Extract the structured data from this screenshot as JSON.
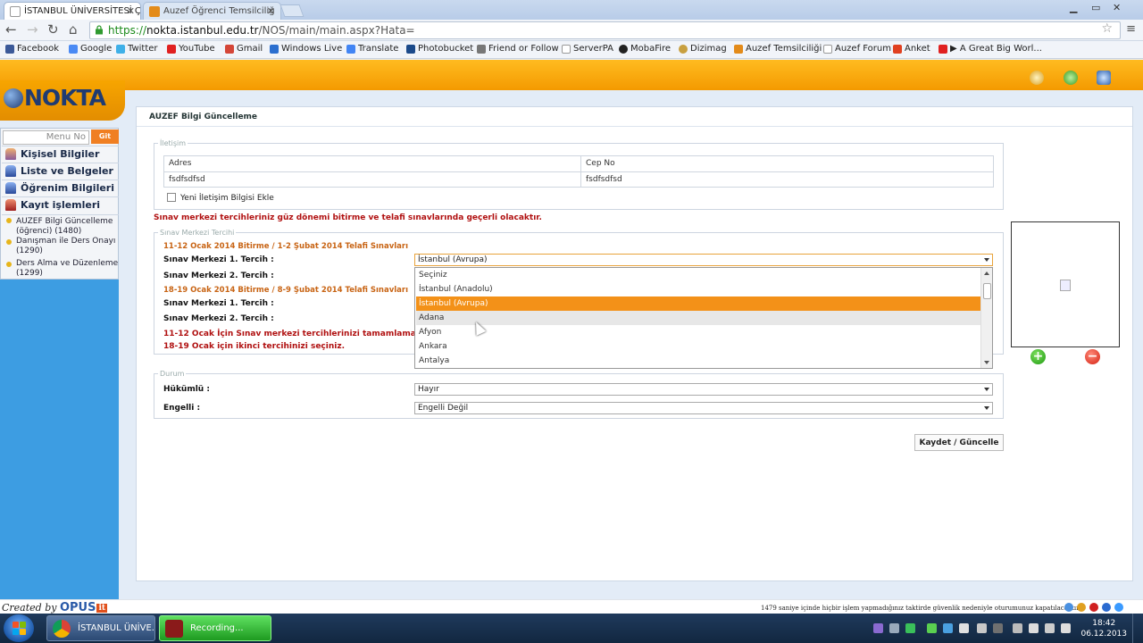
{
  "browser": {
    "tabs": [
      {
        "title": "İSTANBUL ÜNİVERSİTESİ Ç",
        "active": true
      },
      {
        "title": "Auzef Öğrenci Temsilciliğ",
        "active": false
      }
    ],
    "url_scheme": "https://",
    "url_host": "nokta.istanbul.edu.tr",
    "url_path": "/NOS/main/main.aspx?Hata=",
    "bookmarks": [
      "Facebook",
      "Google",
      "Twitter",
      "YouTube",
      "Gmail",
      "Windows Live",
      "Translate",
      "Photobucket",
      "Friend or Follow",
      "ServerPA",
      "MobaFire",
      "Dizimag",
      "Auzef Temsilciliği",
      "Auzef Forum",
      "Anket",
      "A Great Big Worl..."
    ]
  },
  "logo": {
    "text": "NOKTA"
  },
  "sidebar": {
    "menu_no_placeholder": "Menu No",
    "git_label": "Git",
    "items": [
      {
        "label": "Kişisel Bilgiler"
      },
      {
        "label": "Liste ve Belgeler"
      },
      {
        "label": "Öğrenim Bilgileri"
      },
      {
        "label": "Kayıt işlemleri"
      }
    ],
    "subitems": [
      {
        "label": "AUZEF Bilgi Güncelleme (öğrenci) (1480)"
      },
      {
        "label": "Danışman ile Ders Onayı (1290)"
      },
      {
        "label": "Ders Alma ve Düzenleme (1299)"
      }
    ]
  },
  "panel": {
    "title": "AUZEF Bilgi Güncelleme",
    "iletisim": {
      "legend": "İletişim",
      "headers": [
        "Adres",
        "Cep No"
      ],
      "row": [
        "fsdfsdfsd",
        "fsdfsdfsd"
      ],
      "add_checkbox_label": "Yeni İletişim Bilgisi Ekle"
    },
    "notice": "Sınav merkezi tercihleriniz güz dönemi bitirme ve telafi sınavlarında geçerli olacaktır.",
    "sinav": {
      "legend": "Sınav Merkezi Tercihi",
      "period1": "11-12 Ocak 2014 Bitirme / 1-2 Şubat 2014 Telafi Sınavları",
      "period2": "18-19 Ocak 2014 Bitirme / 8-9 Şubat 2014 Telafi Sınavları",
      "pref1_label": "Sınav Merkezi 1. Tercih :",
      "pref2_label": "Sınav Merkezi 2. Tercih :",
      "selected_value": "İstanbul (Avrupa)",
      "options": [
        "Seçiniz",
        "İstanbul (Anadolu)",
        "İstanbul (Avrupa)",
        "Adana",
        "Afyon",
        "Ankara",
        "Antalya"
      ],
      "error1": "11-12 Ocak İçin Sınav merkezi tercihlerinizi tamamlamadınız.",
      "error2": "18-19 Ocak için ikinci tercihinizi seçiniz."
    },
    "durum": {
      "legend": "Durum",
      "hukumlu_label": "Hükümlü :",
      "hukumlu_value": "Hayır",
      "engelli_label": "Engelli :",
      "engelli_value": "Engelli Değil"
    },
    "save_label": "Kaydet / Güncelle"
  },
  "footer": {
    "credit_prefix": "Created by",
    "credit_brand": "OPUS",
    "credit_suffix": "it",
    "session_message": "1479 saniye içinde hiçbir işlem yapmadığınız taktirde güvenlik nedeniyle oturumunuz kapatılacaktır."
  },
  "taskbar": {
    "items": [
      "İSTANBUL ÜNİVE...",
      "Recording..."
    ],
    "time": "18:42",
    "date": "06.12.2013"
  },
  "colors": {
    "accent": "#f39118",
    "sidebar_blue": "#3d9de2",
    "error_red": "#b01010"
  }
}
